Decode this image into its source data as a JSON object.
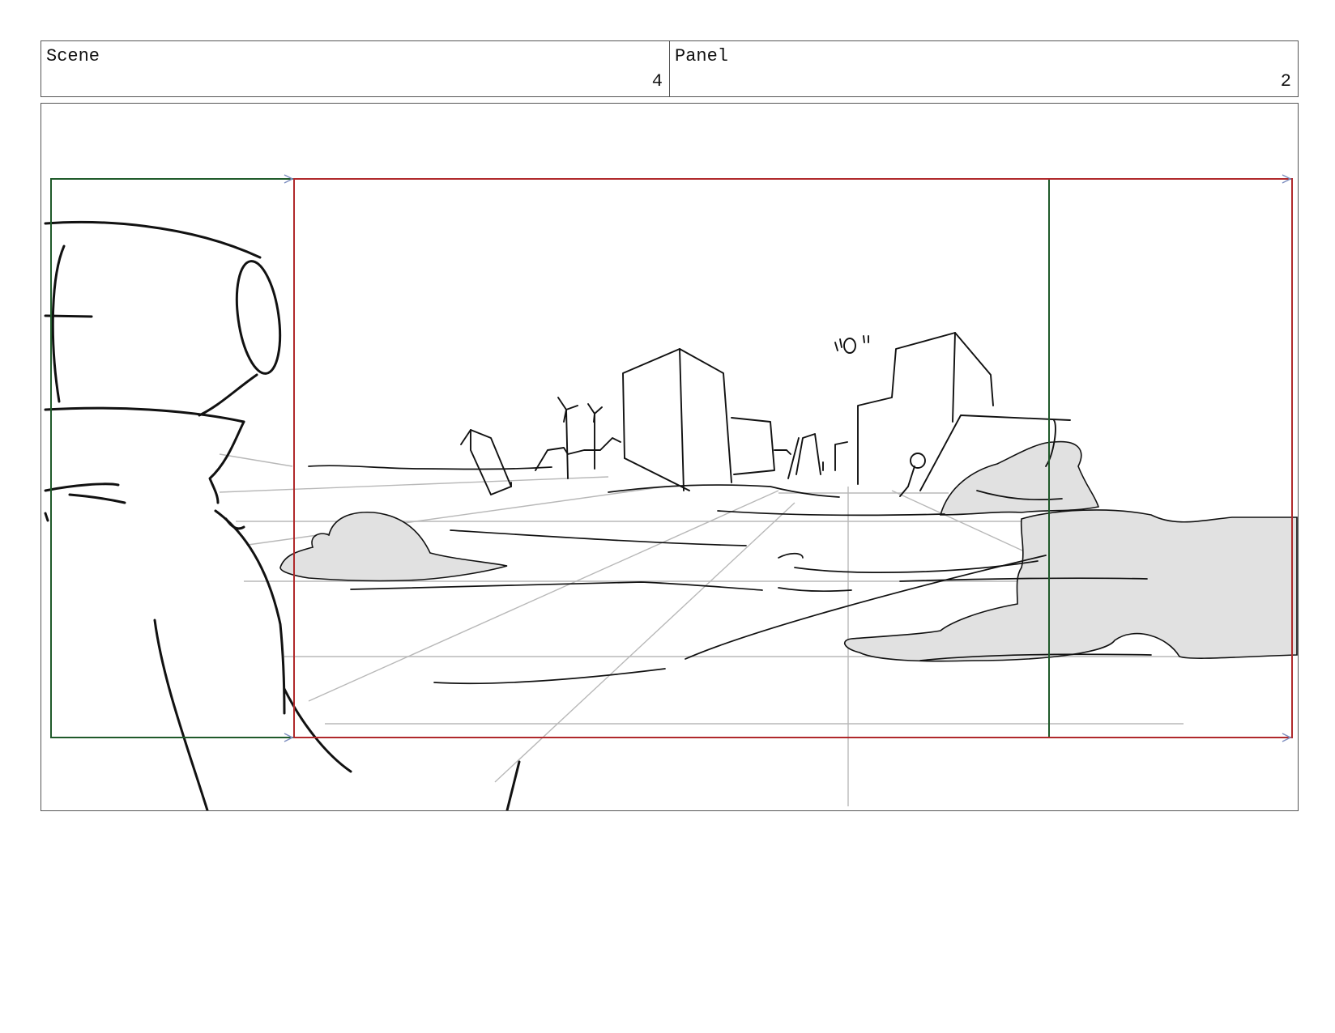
{
  "header": {
    "scene_label": "Scene",
    "scene_number": "4",
    "panel_label": "Panel",
    "panel_number": "2"
  },
  "frame_guides": {
    "start_frame_color": "#1f5a2a",
    "end_frame_color": "#b0292b",
    "camera_move": "pan-right"
  },
  "sketch": {
    "fill_color": "#e1e1e1",
    "line_color": "#111111",
    "perspective_line_color": "#b8b8b8"
  }
}
